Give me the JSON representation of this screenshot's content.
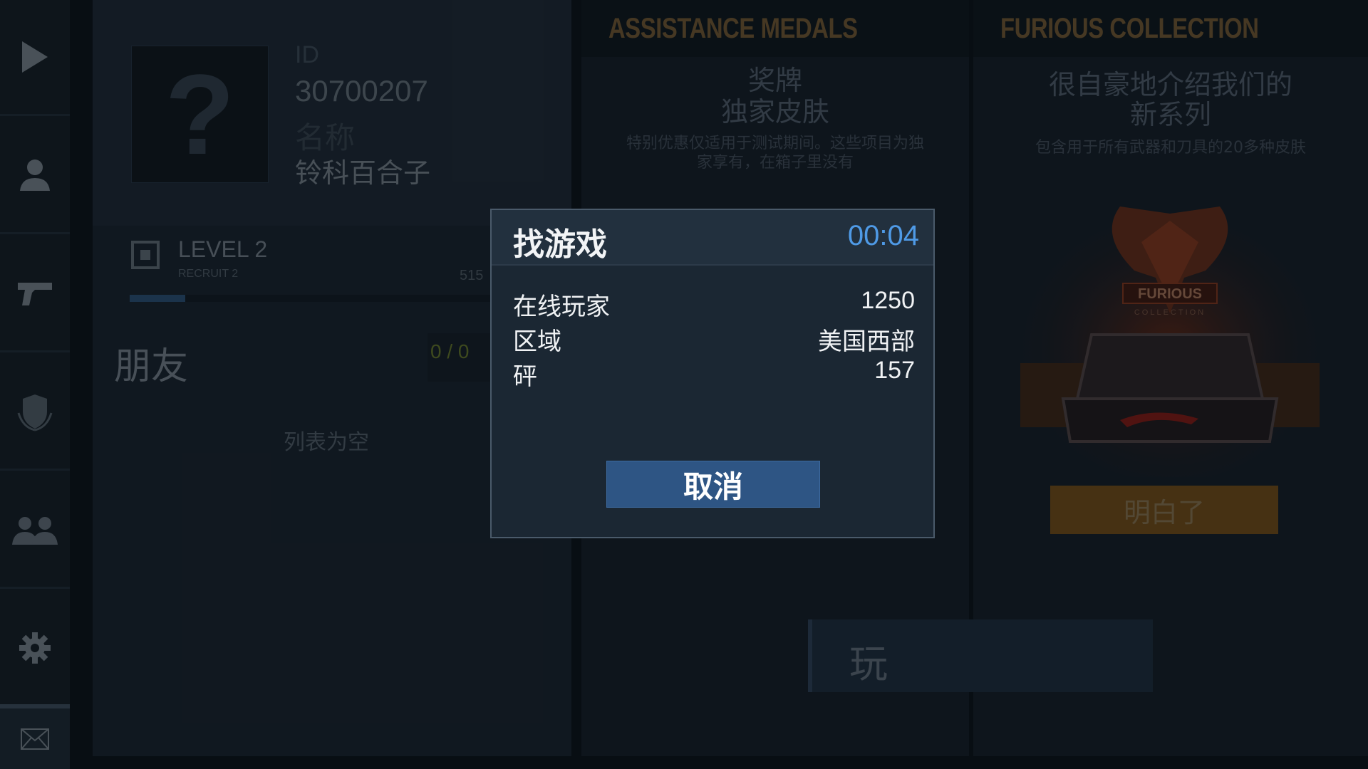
{
  "sidebar": {
    "items": [
      {
        "icon": "play-icon"
      },
      {
        "icon": "profile-icon"
      },
      {
        "icon": "pistol-icon"
      },
      {
        "icon": "shield-icon"
      },
      {
        "icon": "group-icon"
      },
      {
        "icon": "gear-icon"
      },
      {
        "icon": "mail-icon"
      }
    ]
  },
  "profile": {
    "avatar_placeholder": "?",
    "id_label": "ID",
    "id_value": "30700207",
    "name_label": "名称",
    "name_value": "铃科百合子",
    "level_title": "LEVEL 2",
    "level_rank": "RECRUIT 2",
    "xp_text": "515",
    "xp_progress": 0.15
  },
  "friends": {
    "title": "朋友",
    "count": "0 / 0",
    "empty_text": "列表为空"
  },
  "promo_medals": {
    "title": "ASSISTANCE MEDALS",
    "heading_line1": "奖牌",
    "heading_line2": "独家皮肤",
    "desc_line1": "特别优惠仅适用于测试期间。这些项目为独",
    "desc_line2": "家享有，在箱子里没有"
  },
  "promo_furious": {
    "title": "FURIOUS COLLECTION",
    "heading_line1": "很自豪地介绍我们的",
    "heading_line2": "新系列",
    "desc": "包含用于所有武器和刀具的20多种皮肤",
    "badge_text": "FURIOUS",
    "badge_sub": "COLLECTION",
    "understand_label": "明白了"
  },
  "play_button_label": "玩",
  "dialog": {
    "title": "找游戏",
    "timer": "00:04",
    "rows": [
      {
        "label": "在线玩家",
        "value": "1250"
      },
      {
        "label": "区域",
        "value": "美国西部"
      },
      {
        "label": "砰",
        "value": "157"
      }
    ],
    "cancel_label": "取消"
  },
  "colors": {
    "accent_blue": "#4f9ae6",
    "button_blue": "#2e5584",
    "orange_button": "#6a4718",
    "promo_title": "#6b5230"
  }
}
